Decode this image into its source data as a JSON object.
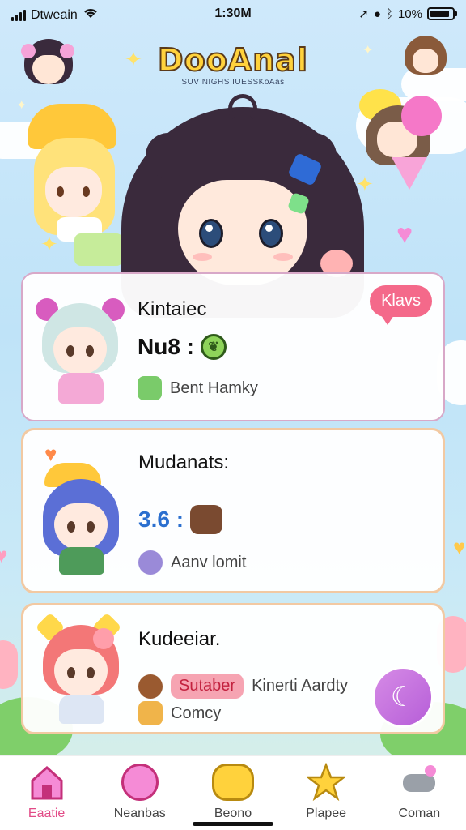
{
  "status_bar": {
    "carrier": "Dtweain",
    "time": "1:30M",
    "battery_text": "10%",
    "battery_level": 0.9
  },
  "header": {
    "logo": "DooAnal",
    "tagline": "SUV NIGHS IUESSKoAas"
  },
  "cards": [
    {
      "title": "Kintaiec",
      "stat": "Nu8 :",
      "subtitle": "Bent Hamky",
      "badge": "Klavs",
      "hair_color": "#cfe6e4",
      "body_color": "#f4a9d6",
      "accent": "#d85cbf"
    },
    {
      "title": "Mudanats:",
      "stat": "3.6 :",
      "subtitle": "Aanv lomit",
      "hair_color": "#5b6fd6",
      "body_color": "#4e9b5a",
      "accent": "#ffb33d"
    },
    {
      "title": "Kudeeiar.",
      "tag": "Sutaber",
      "subtitle_inline": "Kinerti Aardty",
      "subtitle2": "Comcy",
      "hair_color": "#f37777",
      "body_color": "#dde6f4",
      "accent": "#ffd84a"
    }
  ],
  "tabs": [
    {
      "label": "Eaatie",
      "icon": "house-icon",
      "active": true
    },
    {
      "label": "Neanbas",
      "icon": "pink-creature-icon",
      "active": false
    },
    {
      "label": "Beono",
      "icon": "yellow-cat-icon",
      "active": false
    },
    {
      "label": "Plapee",
      "icon": "star-icon",
      "active": false
    },
    {
      "label": "Coman",
      "icon": "controller-icon",
      "active": false
    }
  ],
  "colors": {
    "accent_pink": "#e24b87",
    "badge_pink": "#f4698a",
    "logo_yellow": "#ffd23c"
  }
}
